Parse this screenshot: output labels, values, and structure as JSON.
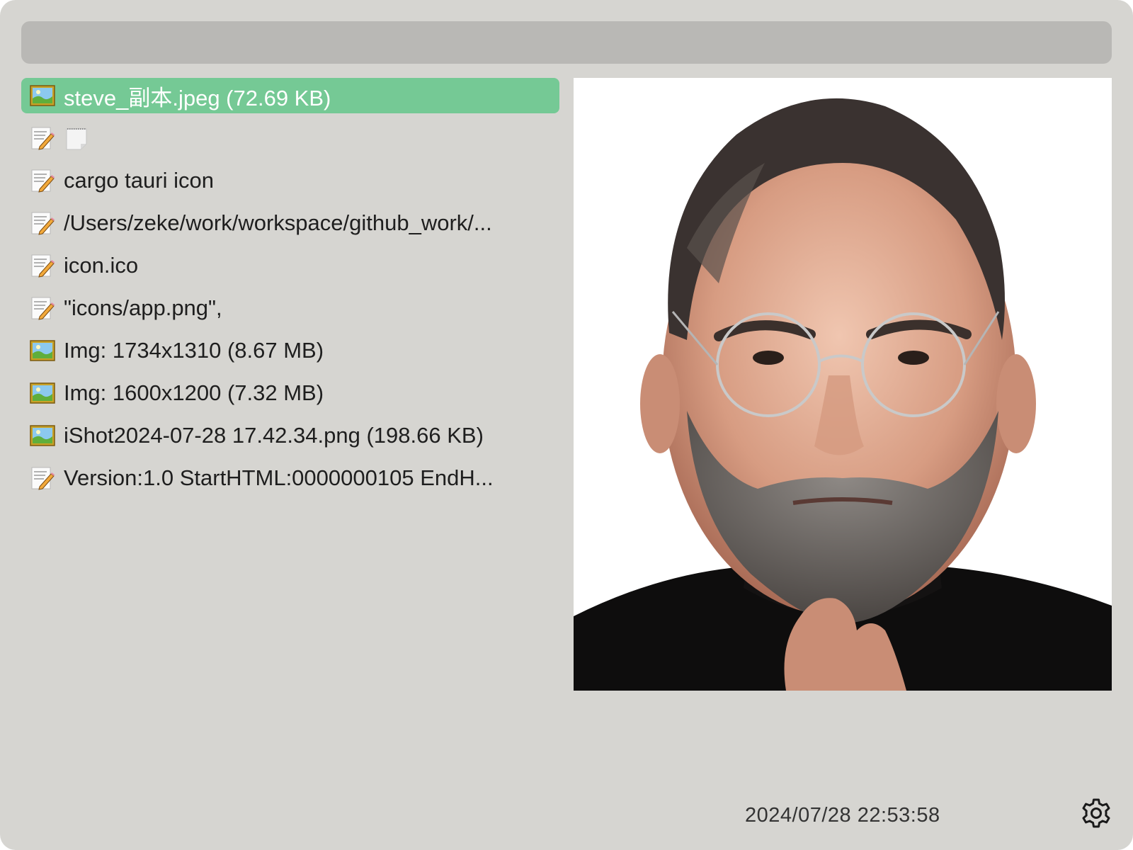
{
  "search": {
    "value": "",
    "placeholder": ""
  },
  "clipboard_items": [
    {
      "type": "image",
      "icon": "image-file-icon",
      "label": "steve_副本.jpeg (72.69 KB)",
      "selected": true
    },
    {
      "type": "text",
      "icon": "text-note-icon",
      "label": "",
      "extra_icon": "blank-note-icon",
      "selected": false
    },
    {
      "type": "text",
      "icon": "text-note-icon",
      "label": "cargo tauri icon",
      "selected": false
    },
    {
      "type": "text",
      "icon": "text-note-icon",
      "label": "/Users/zeke/work/workspace/github_work/...",
      "selected": false
    },
    {
      "type": "text",
      "icon": "text-note-icon",
      "label": "icon.ico",
      "selected": false
    },
    {
      "type": "text",
      "icon": "text-note-icon",
      "label": "\"icons/app.png\",",
      "selected": false
    },
    {
      "type": "image",
      "icon": "image-file-icon",
      "label": "Img: 1734x1310 (8.67 MB)",
      "selected": false
    },
    {
      "type": "image",
      "icon": "image-file-icon",
      "label": "Img: 1600x1200 (7.32 MB)",
      "selected": false
    },
    {
      "type": "image",
      "icon": "image-file-icon",
      "label": "iShot2024-07-28 17.42.34.png (198.66 KB)",
      "selected": false
    },
    {
      "type": "text",
      "icon": "text-note-icon",
      "label": "Version:1.0 StartHTML:0000000105 EndH...",
      "selected": false
    }
  ],
  "preview": {
    "content": "portrait-photo"
  },
  "footer": {
    "timestamp": "2024/07/28 22:53:58",
    "settings_icon": "gear-icon"
  },
  "colors": {
    "window_bg": "#d6d5d1",
    "search_bg": "#b9b8b5",
    "selected_bg": "#75c995"
  }
}
